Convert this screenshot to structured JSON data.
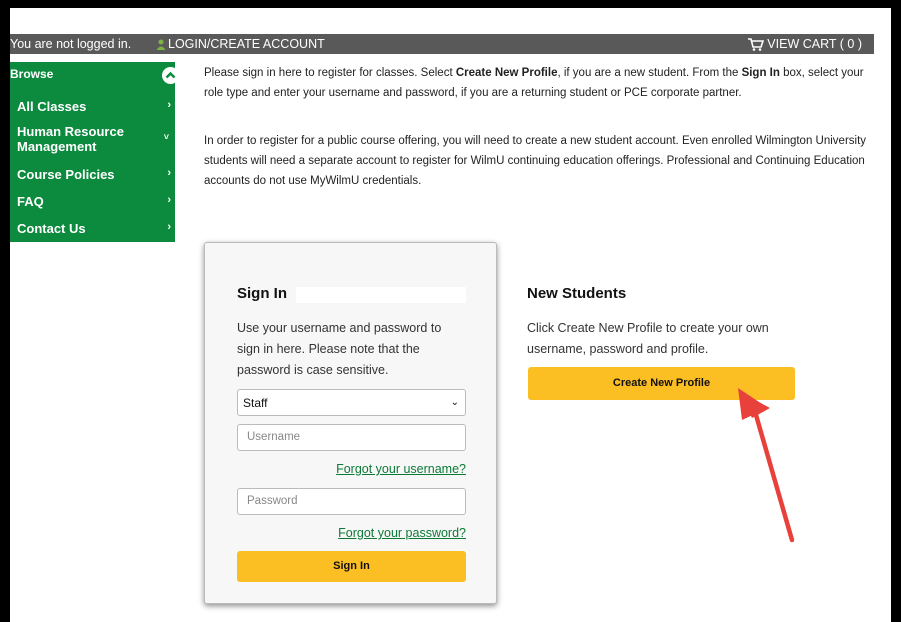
{
  "topbar": {
    "not_logged": "You are not logged in.",
    "login_label": "LOGIN/CREATE ACCOUNT",
    "cart_label": "VIEW CART ( 0 )",
    "person_icon": "person-icon",
    "cart_icon": "cart-icon"
  },
  "sidebar": {
    "heading": "Browse",
    "items": [
      {
        "label": "All Classes"
      },
      {
        "label": "Human Resource Management"
      },
      {
        "label": "Course Policies"
      },
      {
        "label": "FAQ"
      },
      {
        "label": "Contact Us"
      }
    ]
  },
  "intro": {
    "p1_a": "Please sign in here to register for classes. Select ",
    "p1_b": "Create New Profile",
    "p1_c": ", if you are a new student. From the ",
    "p1_d": "Sign In",
    "p1_e": " box, select your role type and enter your username and password, if you are a returning student or PCE corporate partner.",
    "p2": "In order to register for a public course offering, you will need to create a new student account. Even enrolled Wilmington University students will need a separate account to register for WilmU continuing education offerings. Professional and Continuing Education accounts do not use MyWilmU credentials."
  },
  "signin": {
    "title": "Sign In",
    "description": "Use your username and password to sign in here. Please note that the password is case sensitive.",
    "role_selected": "Staff",
    "username_placeholder": "Username",
    "forgot_username": "Forgot your username?",
    "password_placeholder": "Password",
    "forgot_password": "Forgot your password?",
    "button": "Sign In"
  },
  "new_students": {
    "title": "New Students",
    "description": "Click Create New Profile to create your own username, password and profile.",
    "button": "Create New Profile"
  },
  "colors": {
    "sidebar_green": "#0c8a3e",
    "topbar_gray": "#595959",
    "button_yellow": "#fbbf24",
    "link_green": "#0c7a36",
    "annotation_arrow": "#e8403a"
  }
}
